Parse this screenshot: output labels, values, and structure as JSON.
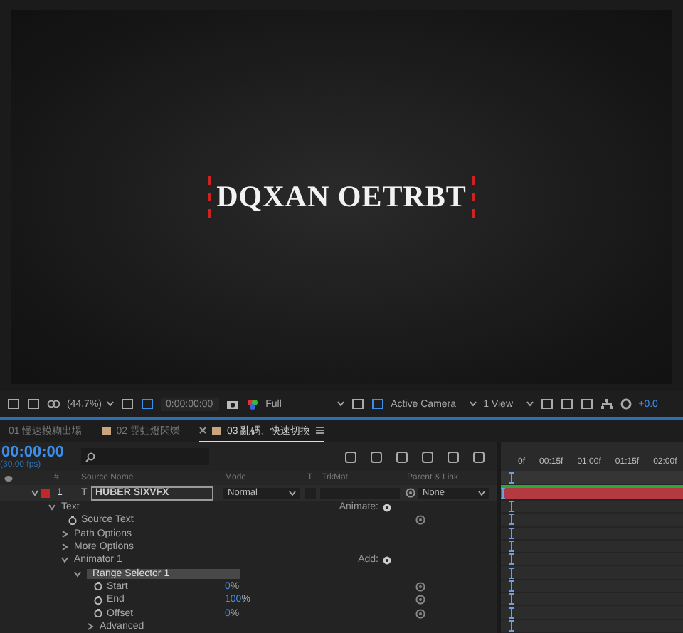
{
  "viewer": {
    "text": "DQXAN OETRBT"
  },
  "viewer_toolbar": {
    "zoom": "(44.7%)",
    "timecode": "0:00:00:00",
    "resolution": "Full",
    "camera": "Active Camera",
    "views": "1 View",
    "exposure": "+0.0"
  },
  "tabs": [
    {
      "label": "01 慢速模糊出場",
      "selected": false,
      "swatch": false
    },
    {
      "label": "02 霓虹燈閃爍",
      "selected": false,
      "swatch": true
    },
    {
      "label": "03 亂碼、快速切換",
      "selected": true,
      "swatch": true
    }
  ],
  "timeline": {
    "current_time": "00:00:00",
    "fps": "(30.00 fps)",
    "ruler": [
      "0f",
      "00:15f",
      "01:00f",
      "01:15f",
      "02:00f"
    ],
    "columns": {
      "number": "#",
      "source_name": "Source Name",
      "mode": "Mode",
      "t": "T",
      "trkmat": "TrkMat",
      "parent": "Parent & Link"
    },
    "layer": {
      "number": "1",
      "type": "T",
      "name": "HUBER SIXVFX",
      "mode": "Normal",
      "parent": "None",
      "expanded": true,
      "preserve_transparency": false,
      "color": "#c0282c"
    },
    "properties": [
      {
        "kind": "group",
        "name": "Text",
        "expanded": true,
        "selected": false,
        "action": "Animate:",
        "children": [
          {
            "kind": "property",
            "name": "Source Text",
            "selected": false
          },
          {
            "kind": "group",
            "name": "Path Options",
            "expanded": false,
            "selected": false
          },
          {
            "kind": "group",
            "name": "More Options",
            "expanded": false,
            "selected": false
          },
          {
            "kind": "group",
            "name": "Animator 1",
            "expanded": true,
            "selected": false,
            "action": "Add:",
            "children": [
              {
                "kind": "group",
                "name": "Range Selector 1",
                "expanded": true,
                "selected": true,
                "children": [
                  {
                    "kind": "property",
                    "name": "Start",
                    "value": "0",
                    "unit": "%",
                    "selected": false
                  },
                  {
                    "kind": "property",
                    "name": "End",
                    "value": "100",
                    "unit": "%",
                    "selected": false
                  },
                  {
                    "kind": "property",
                    "name": "Offset",
                    "value": "0",
                    "unit": "%",
                    "selected": false
                  },
                  {
                    "kind": "group",
                    "name": "Advanced",
                    "expanded": false,
                    "selected": false
                  }
                ]
              }
            ]
          }
        ]
      }
    ]
  }
}
